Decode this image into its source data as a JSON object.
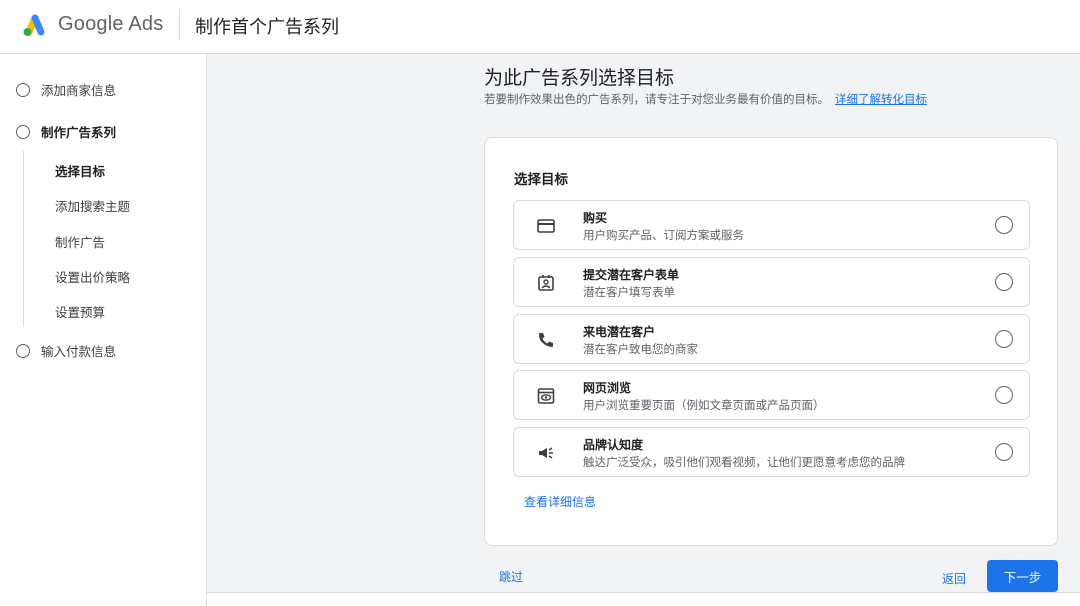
{
  "header": {
    "brand": "Google Ads",
    "title": "制作首个广告系列"
  },
  "sidebar": {
    "steps": [
      {
        "label": "添加商家信息"
      },
      {
        "label": "制作广告系列"
      },
      {
        "label": "输入付款信息"
      }
    ],
    "substeps": [
      {
        "label": "选择目标"
      },
      {
        "label": "添加搜索主题"
      },
      {
        "label": "制作广告"
      },
      {
        "label": "设置出价策略"
      },
      {
        "label": "设置预算"
      }
    ]
  },
  "main": {
    "title": "为此广告系列选择目标",
    "subtitle": "若要制作效果出色的广告系列，请专注于对您业务最有价值的目标。",
    "learn_more": "详细了解转化目标",
    "card_title": "选择目标",
    "goals": [
      {
        "name": "购买",
        "desc": "用户购买产品、订阅方案或服务",
        "icon": "credit-card-icon"
      },
      {
        "name": "提交潜在客户表单",
        "desc": "潜在客户填写表单",
        "icon": "contact-form-icon"
      },
      {
        "name": "来电潜在客户",
        "desc": "潜在客户致电您的商家",
        "icon": "phone-icon"
      },
      {
        "name": "网页浏览",
        "desc": "用户浏览重要页面（例如文章页面或产品页面）",
        "icon": "web-view-icon"
      },
      {
        "name": "品牌认知度",
        "desc": "触达广泛受众，吸引他们观看视频，让他们更愿意考虑您的品牌",
        "icon": "megaphone-icon"
      }
    ],
    "details_link": "查看详细信息"
  },
  "footer": {
    "skip": "跳过",
    "back": "返回",
    "next": "下一步"
  },
  "colors": {
    "accent": "#1a73e8",
    "logo_yellow": "#fbbc04",
    "logo_blue": "#4285f4",
    "logo_green": "#34a853"
  }
}
